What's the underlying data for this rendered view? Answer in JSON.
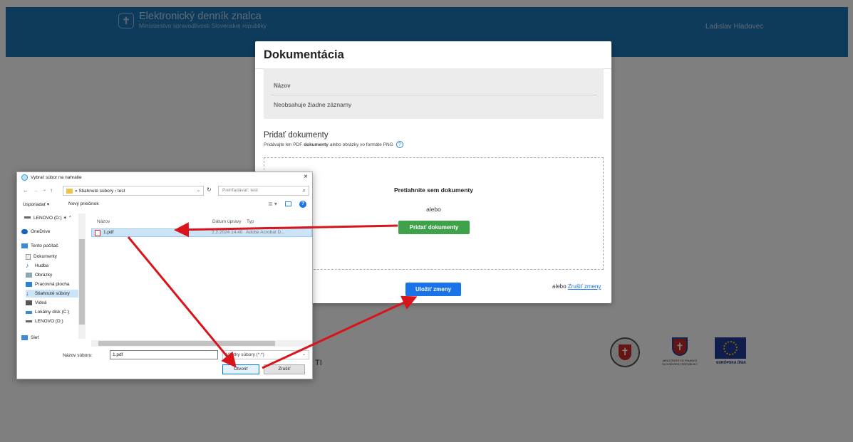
{
  "header": {
    "app_title": "Elektronický denník znalca",
    "app_subtitle": "Ministerstvo spravodlivosti Slovenskej republiky",
    "user_name": "Ladislav Hladovec"
  },
  "footer": {
    "fragment": "TI",
    "logo2_caption": "MINISTERSTVO FINANCIÍ SLOVENSKEJ REPUBLIKY",
    "logo3_caption": "EURÓPSKA ÚNIA"
  },
  "modal": {
    "title": "Dokumentácia",
    "table_header": "Názov",
    "empty_text": "Neobsahuje žiadne záznamy",
    "add_title": "Pridať dokumenty",
    "hint_before": "Pridávajte len PDF",
    "hint_bold": "dokumenty",
    "hint_after": "alebo obrázky vo formáte PNG",
    "help_glyph": "?",
    "drop_text": "Pretiahnite sem dokumenty",
    "or_text": "alebo",
    "add_button": "Pridať dokumenty",
    "save_button": "Uložiť zmeny",
    "or_cancel": "alebo",
    "cancel_link": "Zrušiť zmeny"
  },
  "dialog": {
    "title": "Vybrať súbor na nahratie",
    "close_glyph": "×",
    "nav_back": "←",
    "nav_forward": "→",
    "nav_recent": "⌄",
    "nav_up": "↑",
    "address": "« Stiahnuté súbory › test",
    "address_dropdown": "⌄",
    "refresh": "↻",
    "search_placeholder": "Prehľadávať: test",
    "search_glyph": "⌕",
    "organize": "Usporiadať ▾",
    "new_folder": "Nový priečinok",
    "view_glyph": "≣ ▾",
    "help_glyph": "?",
    "nav_items": [
      "LENOVO (D:) ✶ ⌃",
      "OneDrive",
      "Tento počítač",
      "Dokumenty",
      "Hudba",
      "Obrázky",
      "Pracovná plocha",
      "Stiahnuté súbory",
      "Videá",
      "Lokálny disk (C:)",
      "LENOVO (D:)",
      "Sieť"
    ],
    "columns": {
      "name": "Názov",
      "date": "Dátum úpravy",
      "type": "Typ"
    },
    "file": {
      "name": "1.pdf",
      "date": "2.2.2024 14:40",
      "type": "Adobe Acrobat D..."
    },
    "filename_label": "Názov súboru:",
    "filename_value": "1.pdf",
    "filter_value": "Všetky súbory (*.*)",
    "filter_dropdown": "⌄",
    "open_button": "Otvoriť",
    "cancel_button": "Zrušiť"
  },
  "colors": {
    "header_blue": "#1d74b6",
    "add_button_green": "#3fa24b",
    "save_button_blue": "#1a73e8",
    "arrow_red": "#d9141b"
  }
}
